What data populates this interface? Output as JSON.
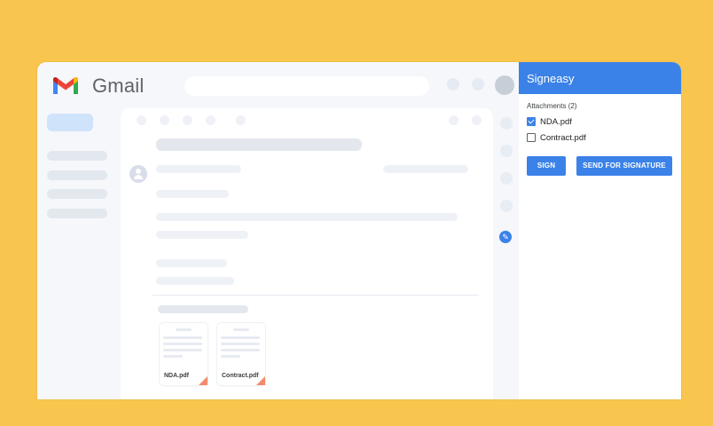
{
  "gmail": {
    "app_name": "Gmail",
    "attachments": [
      {
        "name": "NDA.pdf"
      },
      {
        "name": "Contract.pdf"
      }
    ]
  },
  "signeasy": {
    "title": "Signeasy",
    "attachments_label": "Attachments (2)",
    "files": [
      {
        "name": "NDA.pdf",
        "checked": true
      },
      {
        "name": "Contract.pdf",
        "checked": false
      }
    ],
    "buttons": {
      "sign": "SIGN",
      "send_for_signature": "SEND FOR SIGNATURE"
    }
  },
  "colors": {
    "background": "#f8c54e",
    "accent": "#3b82e8",
    "pdf_corner": "#f28b6c"
  },
  "icons": [
    "gmail-logo",
    "user-avatar-icon",
    "signeasy-pen-icon",
    "checkbox-checked-icon",
    "checkbox-unchecked-icon"
  ]
}
